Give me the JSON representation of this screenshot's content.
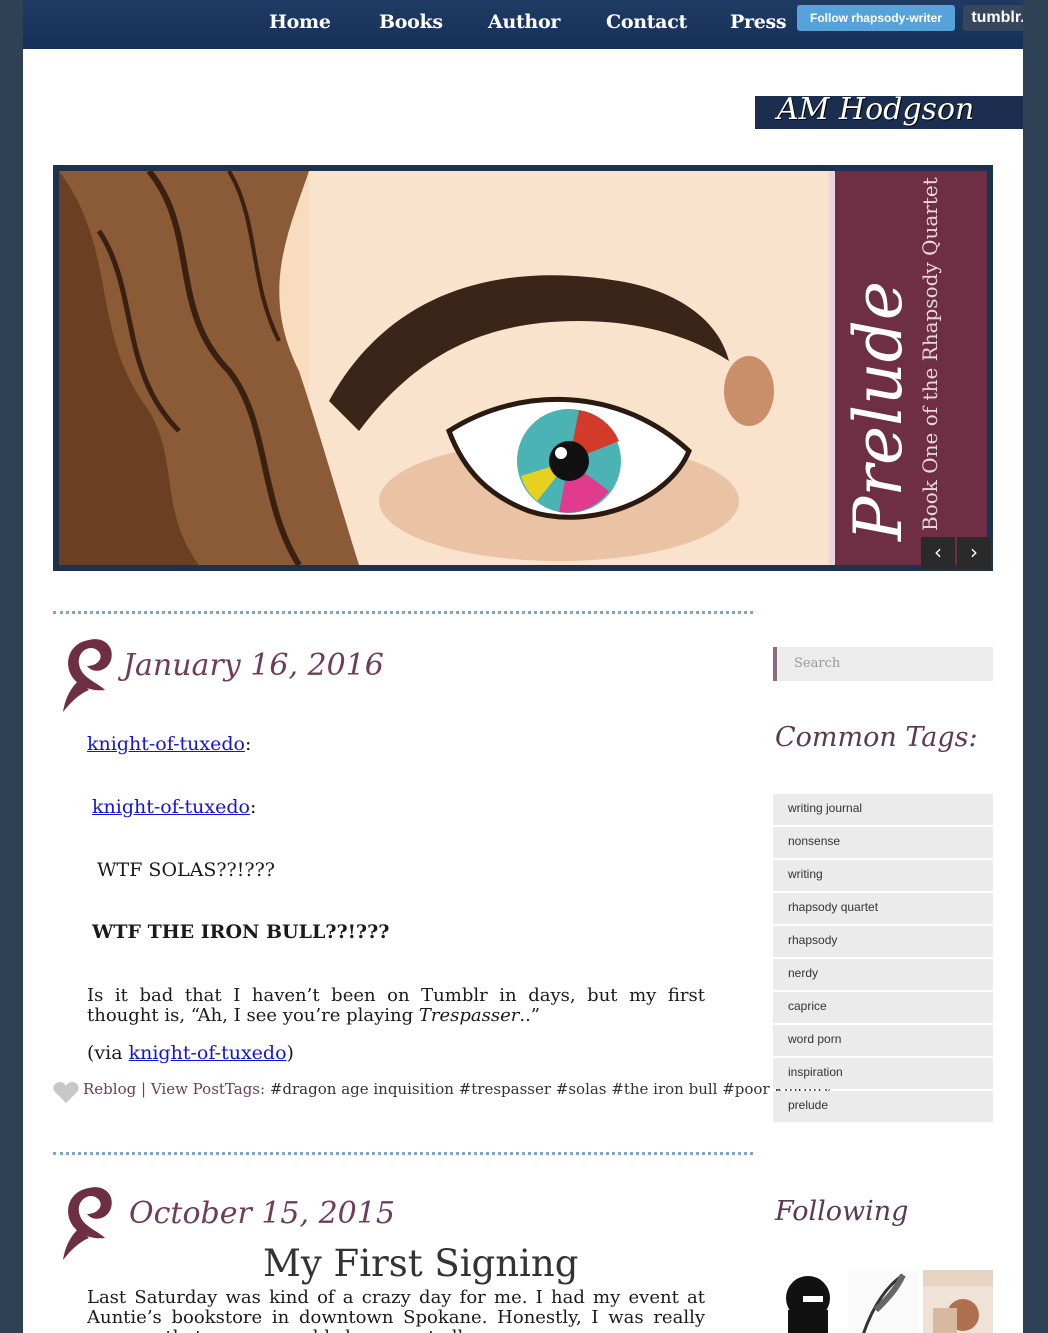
{
  "nav": {
    "items": [
      {
        "label": "Home"
      },
      {
        "label": "Books"
      },
      {
        "label": "Author"
      },
      {
        "label": "Contact"
      },
      {
        "label": "Press"
      }
    ],
    "follow_label": "Follow rhapsody-writer",
    "tumblr_label": "tumblr."
  },
  "site": {
    "title": "AM Hodgson"
  },
  "slider": {
    "book_title": "Prelude",
    "book_subtitle": "Book One of the Rhapsody Quartet",
    "prev_icon": "‹",
    "next_icon": "›"
  },
  "posts": [
    {
      "date": "January 16, 2016",
      "lines": [
        {
          "link": "knight-of-tuxedo",
          "suffix": ":"
        },
        {
          "link": "knight-of-tuxedo",
          "suffix": ":"
        }
      ],
      "quote1": "WTF SOLAS??!???",
      "quote2": "WTF THE IRON BULL??!???",
      "body_pre": "Is it bad that I haven’t been on Tumblr in days, but my first thought is, “Ah, I see you’re playing ",
      "body_em": "Trespasser",
      "body_post": "..”",
      "via_pre": "(via ",
      "via_link": "knight-of-tuxedo",
      "via_post": ")",
      "reblog": "Reblog",
      "sep": "|",
      "view_post": "View Post",
      "tags_label": "Tags:",
      "tags": "#dragon age inquisition #trespasser #solas #the iron bull #poor knighty"
    },
    {
      "date": "October 15, 2015",
      "title": "My First Signing",
      "body": "Last Saturday was kind of a crazy day for me. I had my event at Auntie’s bookstore in downtown Spokane. Honestly, I was really nervous that no one would show up at all."
    }
  ],
  "sidebar": {
    "search_placeholder": "Search",
    "common_tags_heading": "Common Tags:",
    "tags": [
      "writing journal",
      "nonsense",
      "writing",
      "rhapsody quartet",
      "rhapsody",
      "nerdy",
      "caprice",
      "word porn",
      "inspiration",
      "prelude"
    ],
    "following_heading": "Following"
  },
  "colors": {
    "nav_bg": "#1f3b63",
    "accent": "#6e3d5a",
    "link": "#1414d8",
    "follow_button": "#56a3d9",
    "page_bg": "#2f4255"
  }
}
